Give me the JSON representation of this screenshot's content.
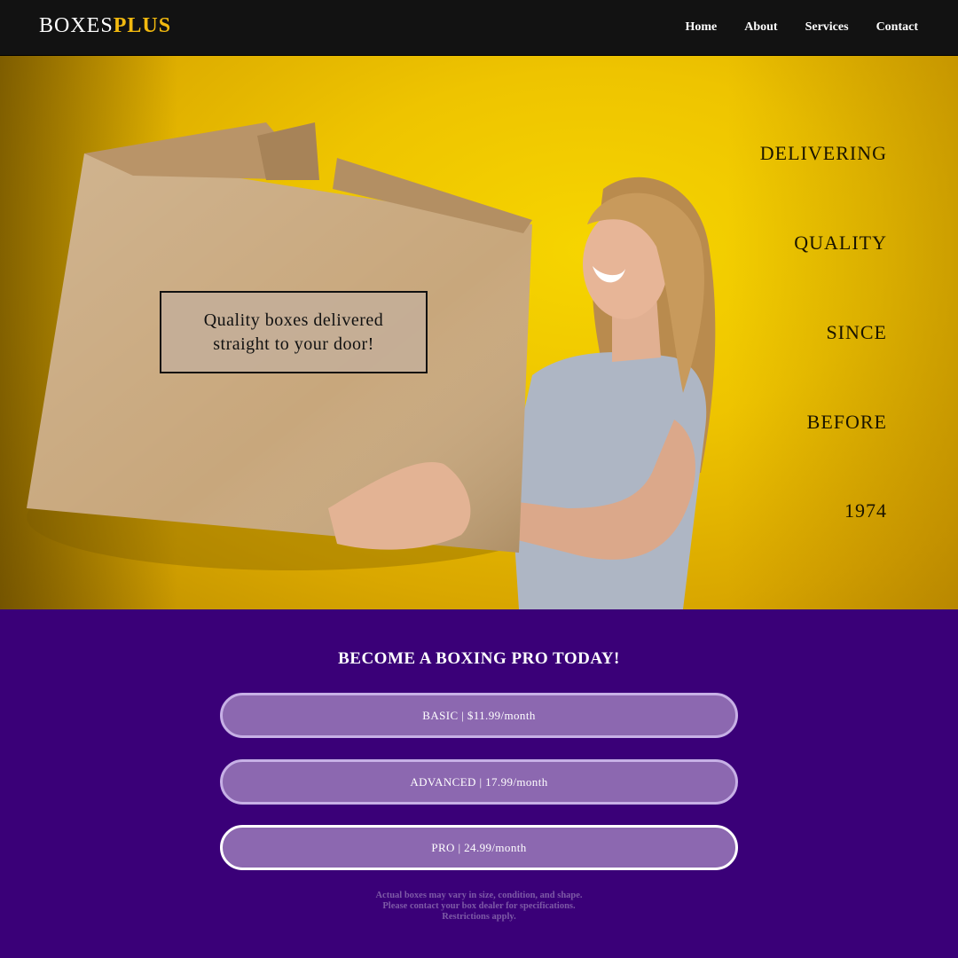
{
  "nav": {
    "brand_part1": "BOXES",
    "brand_part2": "PLUS",
    "links": [
      "Home",
      "About",
      "Services",
      "Contact"
    ]
  },
  "hero": {
    "tagline": "Quality boxes delivered straight to your door!",
    "slogan": [
      "DELIVERING",
      "QUALITY",
      "SINCE",
      "BEFORE",
      "1974"
    ]
  },
  "pricing": {
    "heading": "BECOME A BOXING PRO TODAY!",
    "plans": [
      "BASIC | $11.99/month",
      "ADVANCED | 17.99/month",
      "PRO | 24.99/month"
    ],
    "disclaimer": [
      "Actual boxes may vary in size, condition, and shape.",
      "Please contact your box dealer for specifications.",
      "Restrictions apply."
    ]
  },
  "colors": {
    "navbar": "#121212",
    "brand_accent": "#f2b90f",
    "hero_yellow": "#eec400",
    "pricing_bg": "#3a0078",
    "plan_fill": "#8c68b0",
    "plan_border": "#c7b0e6"
  }
}
